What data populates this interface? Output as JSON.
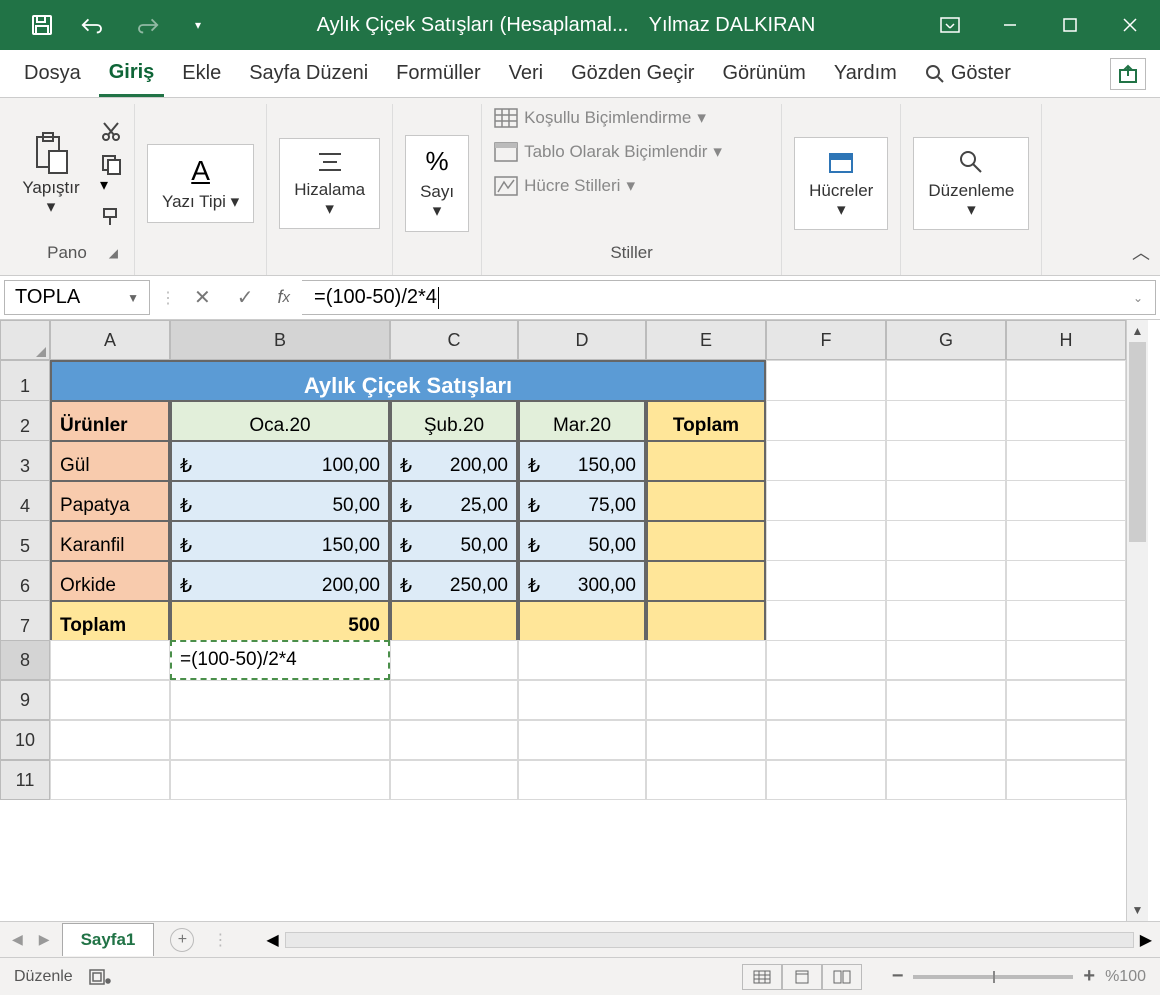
{
  "titlebar": {
    "doc_title": "Aylık Çiçek Satışları (Hesaplamal...",
    "user": "Yılmaz DALKIRAN"
  },
  "tabs": {
    "file": "Dosya",
    "home": "Giriş",
    "insert": "Ekle",
    "layout": "Sayfa Düzeni",
    "formulas": "Formüller",
    "data": "Veri",
    "review": "Gözden Geçir",
    "view": "Görünüm",
    "help": "Yardım",
    "search": "Göster"
  },
  "ribbon": {
    "clipboard": {
      "paste": "Yapıştır",
      "group": "Pano"
    },
    "font": {
      "btn": "Yazı Tipi"
    },
    "align": {
      "btn": "Hizalama"
    },
    "number": {
      "btn": "Sayı"
    },
    "styles": {
      "cond": "Koşullu Biçimlendirme",
      "table": "Tablo Olarak Biçimlendir",
      "cellstyles": "Hücre Stilleri",
      "group": "Stiller"
    },
    "cells": {
      "btn": "Hücreler"
    },
    "editing": {
      "btn": "Düzenleme"
    }
  },
  "fx": {
    "name": "TOPLA",
    "formula": "=(100-50)/2*4"
  },
  "columns": [
    "A",
    "B",
    "C",
    "D",
    "E",
    "F",
    "G",
    "H"
  ],
  "rows": [
    "1",
    "2",
    "3",
    "4",
    "5",
    "6",
    "7",
    "8",
    "9",
    "10",
    "11"
  ],
  "table": {
    "title": "Aylık Çiçek Satışları",
    "hdr_products": "Ürünler",
    "months": [
      "Oca.20",
      "Şub.20",
      "Mar.20"
    ],
    "hdr_total": "Toplam",
    "currency": "₺",
    "rows": [
      {
        "name": "Gül",
        "vals": [
          "100,00",
          "200,00",
          "150,00"
        ]
      },
      {
        "name": "Papatya",
        "vals": [
          "50,00",
          "25,00",
          "75,00"
        ]
      },
      {
        "name": "Karanfil",
        "vals": [
          "150,00",
          "50,00",
          "50,00"
        ]
      },
      {
        "name": "Orkide",
        "vals": [
          "200,00",
          "250,00",
          "300,00"
        ]
      }
    ],
    "total_label": "Toplam",
    "total_b": "500",
    "editing_cell": "=(100-50)/2*4"
  },
  "sheet_tab": "Sayfa1",
  "status": {
    "mode": "Düzenle",
    "zoom": "%100"
  }
}
